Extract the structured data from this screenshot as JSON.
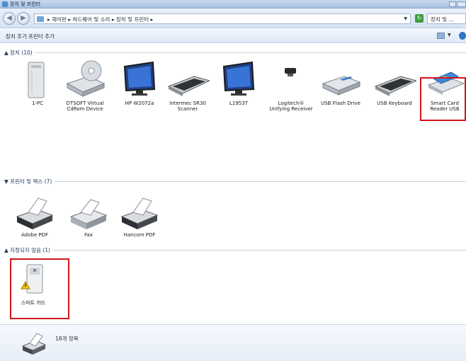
{
  "window": {
    "title": "장치 및 프린터"
  },
  "address": {
    "crumbs": "▸ 제어판 ▸ 하드웨어 및 소리 ▸ 장치 및 프린터 ▸",
    "search_placeholder": "장치 및 ..."
  },
  "commands": {
    "add_device": "장치 추가",
    "add_printer": "프린터 추가"
  },
  "groups": {
    "devices": {
      "header": "장치 (10)",
      "items": [
        {
          "label": "1-PC",
          "icon": "tower-pc-icon"
        },
        {
          "label": "DTSOFT Virtual CdRom Device",
          "icon": "cd-drive-icon"
        },
        {
          "label": "HP W2072a",
          "icon": "monitor-icon"
        },
        {
          "label": "Intermec SR30 Scanner",
          "icon": "keyboard-icon"
        },
        {
          "label": "L1953T",
          "icon": "monitor-icon"
        },
        {
          "label": "Logitech® Unifying Receiver",
          "icon": "usb-receiver-icon"
        },
        {
          "label": "USB Flash Drive",
          "icon": "drive-icon"
        },
        {
          "label": "USB Keyboard",
          "icon": "keyboard-icon"
        },
        {
          "label": "Smart Card Reader USB",
          "icon": "card-reader-icon"
        }
      ]
    },
    "printers": {
      "header": "프린터 및 팩스 (7)",
      "items": [
        {
          "label": "Adobe PDF",
          "icon": "printer-icon"
        },
        {
          "label": "Fax",
          "icon": "fax-icon"
        },
        {
          "label": "Hancom PDF",
          "icon": "printer-icon"
        }
      ]
    },
    "unspecified": {
      "header": "지정되지 않음 (1)",
      "items": [
        {
          "label": "스마트 카드",
          "icon": "warning-device-icon"
        }
      ]
    }
  },
  "details": {
    "count": "18개 항목"
  },
  "colors": {
    "highlight": "#d0151c",
    "header_text": "#1e395b"
  }
}
